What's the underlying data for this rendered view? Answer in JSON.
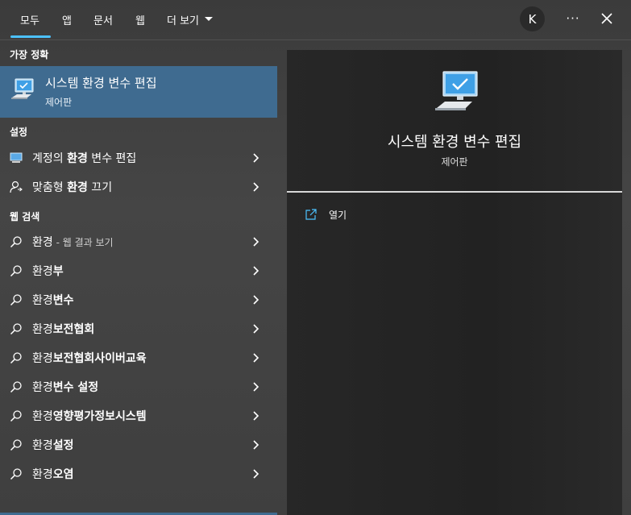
{
  "tabs": [
    {
      "label": "모두"
    },
    {
      "label": "앱"
    },
    {
      "label": "문서"
    },
    {
      "label": "웹"
    },
    {
      "label": "더 보기"
    }
  ],
  "avatar": {
    "initial": "K"
  },
  "more": {
    "label": "···"
  },
  "sections": {
    "best_match": "가장 정확",
    "settings": "설정",
    "web_search": "웹 검색"
  },
  "best_match": {
    "title": "시스템 환경 변수 편집",
    "subtitle": "제어판",
    "icon": "monitor-check-icon"
  },
  "settings_items": [
    {
      "prefix": "계정의 ",
      "bold": "환경",
      "suffix": " 변수 편집",
      "icon": "monitor-icon"
    },
    {
      "prefix": "맞춤형 ",
      "bold": "환경",
      "suffix": " 끄기",
      "icon": "person-icon"
    }
  ],
  "web_items": [
    {
      "prefix": "환경",
      "bold": "",
      "dim": " - 웹 결과 보기"
    },
    {
      "prefix": "환경",
      "bold": "부",
      "dim": ""
    },
    {
      "prefix": "환경",
      "bold": "변수",
      "dim": ""
    },
    {
      "prefix": "환경",
      "bold": "보전협회",
      "dim": ""
    },
    {
      "prefix": "환경",
      "bold": "보전협회사이버교육",
      "dim": ""
    },
    {
      "prefix": "환경",
      "bold": "변수 설정",
      "dim": ""
    },
    {
      "prefix": "환경",
      "bold": "영향평가정보시스템",
      "dim": ""
    },
    {
      "prefix": "환경",
      "bold": "설정",
      "dim": ""
    },
    {
      "prefix": "환경",
      "bold": "오염",
      "dim": ""
    }
  ],
  "detail": {
    "title": "시스템 환경 변수 편집",
    "subtitle": "제어판",
    "actions": [
      {
        "label": "열기",
        "icon": "open-external-icon"
      }
    ]
  },
  "colors": {
    "accent": "#4cc2ff",
    "selected_row": "#3f6b90",
    "panel_bg": "#3a3a3a",
    "detail_bg": "#262626"
  }
}
